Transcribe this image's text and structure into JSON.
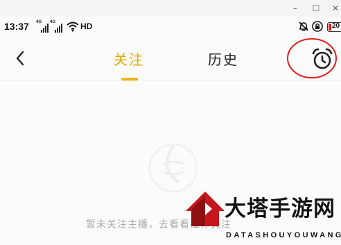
{
  "window": {
    "minimize_glyph": "–",
    "maximize_glyph": "☐",
    "close_glyph": "✕"
  },
  "status_bar": {
    "time": "13:37",
    "signal_1_tag": "4G",
    "signal_2_tag": "4G",
    "hd_label": "HD",
    "battery_level": "20",
    "icons": [
      "signal-icon",
      "wifi-icon",
      "hd-icon",
      "bell-mute-icon",
      "lock-icon",
      "battery-icon"
    ]
  },
  "header": {
    "back_icon": "chevron-left-icon",
    "tabs": [
      {
        "label": "关注",
        "active": true
      },
      {
        "label": "历史",
        "active": false
      }
    ],
    "alarm_icon": "alarm-clock-icon",
    "accent_color": "#f0b21a",
    "highlight_color": "#e02020"
  },
  "empty_state": {
    "icon": "empty-placeholder-icon",
    "message": "暂未关注主播，去看看推荐关注"
  },
  "watermark": {
    "title": "大塔手游网",
    "subtitle": "DATASHOUYOUWANG"
  }
}
